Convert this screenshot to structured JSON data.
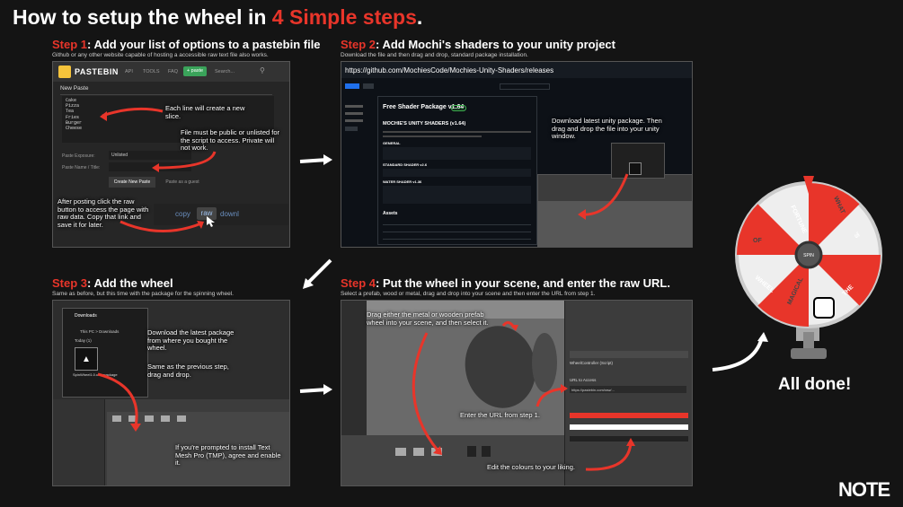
{
  "title": {
    "prefix": "How to setup the wheel in ",
    "highlight": "4 Simple steps",
    "suffix": "."
  },
  "colors": {
    "accent": "#e8352a",
    "background": "#141414",
    "pastebin_bg": "#262626"
  },
  "step1": {
    "label": "Step 1",
    "heading": ": Add your list of options to a pastebin file",
    "sub": "Github or any other website capable of hosting a accessible raw text file also works.",
    "brand": "PASTEBIN",
    "nav": [
      "API",
      "TOOLS",
      "FAQ"
    ],
    "paste_button": "+ paste",
    "search_placeholder": "Search...",
    "new_paste": "New Paste",
    "lines": [
      "Cake",
      "Pizza",
      "Tea",
      "Fries",
      "Burger",
      "Cheese"
    ],
    "exposure_label": "Paste Exposure:",
    "exposure_value": "Unlisted",
    "name_label": "Paste Name / Title:",
    "create_button": "Create New Paste",
    "guest_button": "Paste as a guest",
    "copy": "copy",
    "raw": "raw",
    "download": "downl",
    "note1": "Each line will create a new slice.",
    "note2": "File must be public or unlisted for the script to access. Private will not work.",
    "note3": "After posting click the raw button to access the page with raw data. Copy that link and save it for later."
  },
  "step2": {
    "label": "Step 2",
    "heading": ": Add Mochi's shaders to your unity project",
    "sub": "Download the file and then drag and drop, standard package installation.",
    "url": "https://github.com/MochiesCode/Mochies-Unity-Shaders/releases",
    "release": "Free Shader Package v1.64",
    "latest": "Latest",
    "mochie_title": "MOCHIE'S UNITY SHADERS (v1.64)",
    "general": "GENERAL",
    "standard": "STANDARD SHADER v2.6",
    "water": "WATER SHADER v1.36",
    "assets": "Assets",
    "note": "Download latest unity package. Then drag and drop the file into your unity window."
  },
  "step3": {
    "label": "Step 3",
    "heading": ": Add the wheel",
    "sub": "Same as before, but this time with the package for the spinning wheel.",
    "folder": "Downloads",
    "path": "This PC  >  Downloads",
    "today": "Today (1)",
    "file": "SpinWheel1.0.unitypackage",
    "note1": "Download the latest package from where you bought the wheel.",
    "note2": "Same as the previous step, drag and drop.",
    "note3": "If you're prompted to install Text Mesh Pro (TMP), agree and enable it."
  },
  "step4": {
    "label": "Step 4",
    "heading": ": Put the wheel in your scene, and enter the raw URL.",
    "sub": "Select a prefab, wood or metal, drag and drop into your scene and then enter the URL from step 1.",
    "inspector_title": "WheelController (Script)",
    "url_label": "URL to Access",
    "url_value": "https://pastebin.com/raw/...",
    "note1": "Drag either the metal or wooden prefab wheel into your scene, and then select it.",
    "note2": "Enter the URL from step 1.",
    "note3": "Edit the colours to your liking."
  },
  "wheel": {
    "labels": [
      "FORTUNE",
      "WHAT",
      "'S",
      "OF",
      "WHEEL",
      "MAGICAL",
      "THE"
    ],
    "center": "SPIN"
  },
  "done": "All done!",
  "logo": "NOTE"
}
